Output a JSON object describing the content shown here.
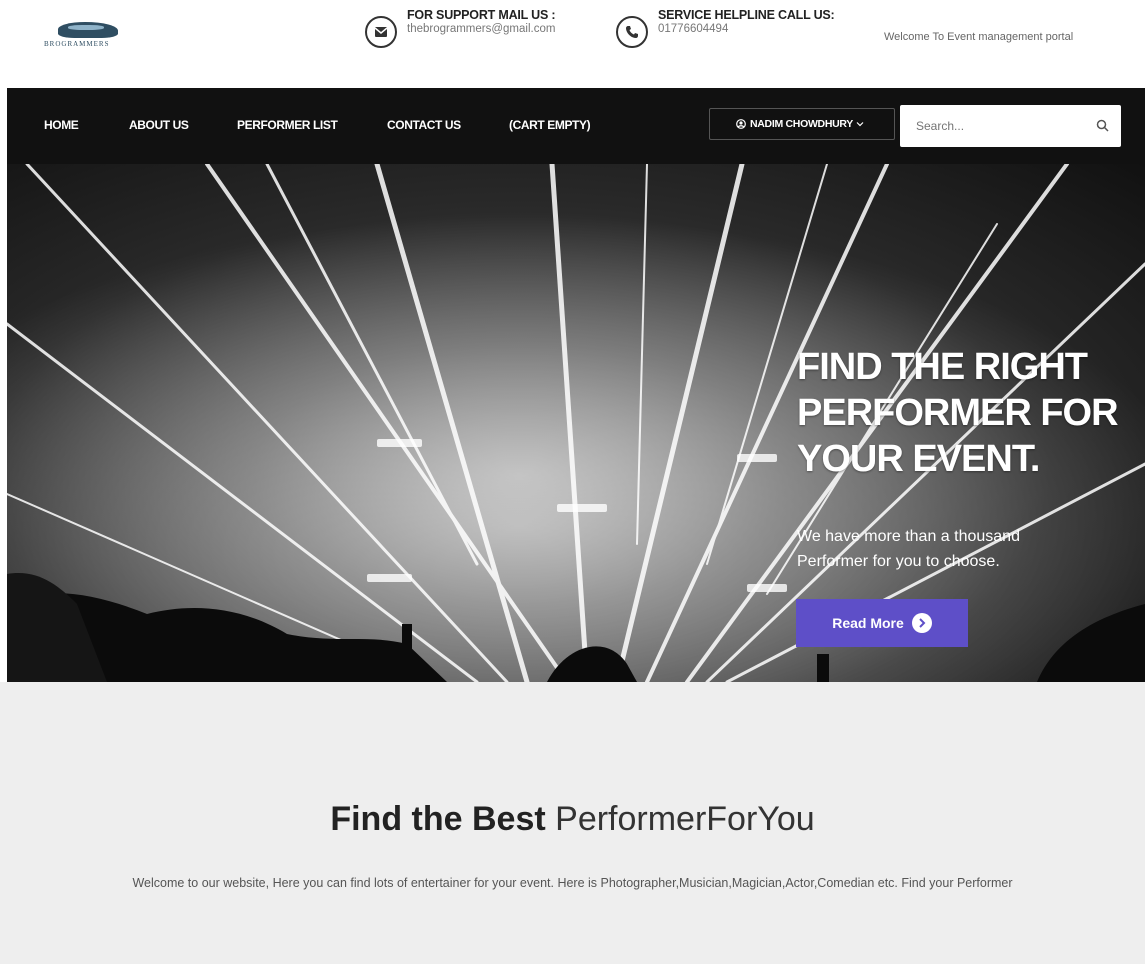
{
  "header": {
    "logo_text": "BROGRAMMERS",
    "support": {
      "title": "FOR SUPPORT MAIL US :",
      "value": "thebrogrammers@gmail.com"
    },
    "helpline": {
      "title": "SERVICE HELPLINE CALL US:",
      "value": "01776604494"
    },
    "welcome": "Welcome To Event management portal"
  },
  "nav": {
    "items": [
      "HOME",
      "ABOUT US",
      "PERFORMER LIST",
      "CONTACT US",
      "(CART EMPTY)"
    ],
    "user": "NADIM CHOWDHURY",
    "search_placeholder": "Search..."
  },
  "hero": {
    "heading": "FIND THE RIGHT PERFORMER FOR YOUR EVENT.",
    "subtext": "We have more than a thousand Performer for you to choose.",
    "button": "Read More"
  },
  "section": {
    "title_bold": "Find the Best",
    "title_light": "PerformerForYou",
    "text": "Welcome to our website, Here you can find lots of entertainer for your event. Here is Photographer,Musician,Magician,Actor,Comedian etc. Find your Performer"
  },
  "colors": {
    "nav_bg": "#111111",
    "accent": "#5e4fc8",
    "section_bg": "#eeeeee"
  }
}
